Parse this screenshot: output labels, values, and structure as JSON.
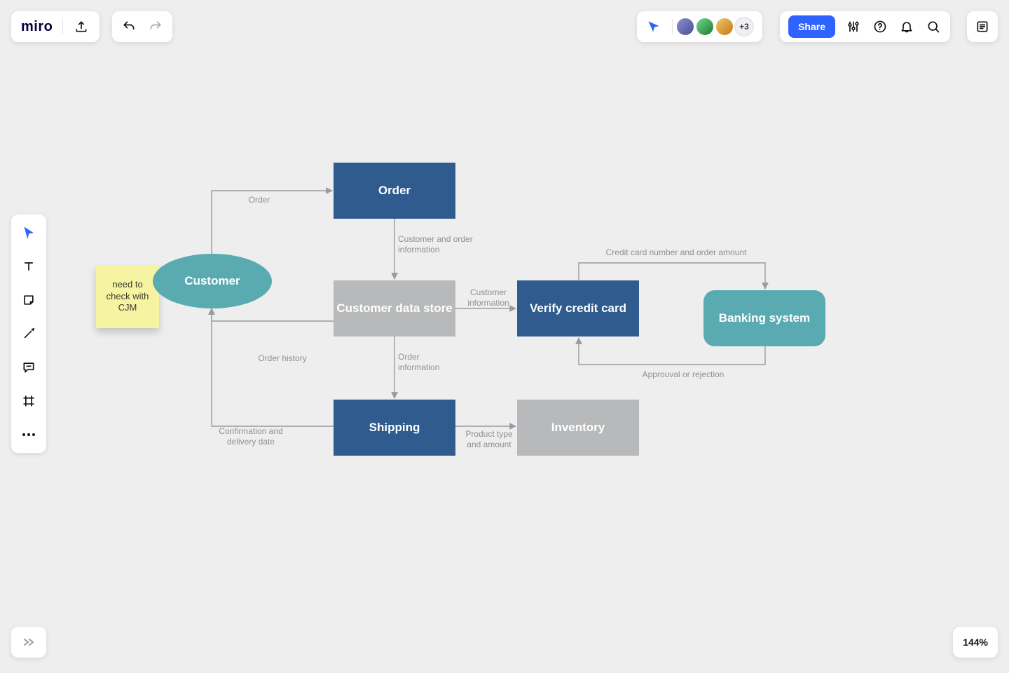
{
  "brand": {
    "name": "miro"
  },
  "presence": {
    "avatars_visible": 3,
    "overflow_label": "+3",
    "avatar_colors": [
      "#5b5f9e",
      "#2f9e44",
      "#e8a13a"
    ]
  },
  "actions": {
    "share_label": "Share"
  },
  "zoom": {
    "label": "144%"
  },
  "sticky": {
    "text": "need to check with CJM"
  },
  "nodes": {
    "customer": "Customer",
    "order": "Order",
    "cds": "Customer data store",
    "verify": "Verify credit card",
    "banking": "Banking system",
    "shipping": "Shipping",
    "inventory": "Inventory"
  },
  "labels": {
    "order_edge": "Order",
    "cust_order_info": "Customer and order\ninformation",
    "order_history": "Order history",
    "cust_info": "Customer\ninformation",
    "order_info": "Order\ninformation",
    "confirm": "Confirmation and\ndelivery date",
    "prod_amount": "Product type\nand amount",
    "cc_num": "Credit card number and order amount",
    "approval": "Approuval or rejection"
  },
  "chart_data": {
    "type": "flowchart",
    "title": "",
    "nodes": [
      {
        "id": "customer",
        "label": "Customer",
        "shape": "ellipse",
        "fill": "#5aaab2"
      },
      {
        "id": "order",
        "label": "Order",
        "shape": "rect",
        "fill": "#2f5b8e"
      },
      {
        "id": "cds",
        "label": "Customer data store",
        "shape": "rect",
        "fill": "#b8b9ba"
      },
      {
        "id": "verify",
        "label": "Verify credit card",
        "shape": "rect",
        "fill": "#2f5b8e"
      },
      {
        "id": "banking",
        "label": "Banking system",
        "shape": "rounded-rect",
        "fill": "#5aaab2"
      },
      {
        "id": "shipping",
        "label": "Shipping",
        "shape": "rect",
        "fill": "#2f5b8e"
      },
      {
        "id": "inventory",
        "label": "Inventory",
        "shape": "rect",
        "fill": "#b8b9ba"
      }
    ],
    "edges": [
      {
        "from": "customer",
        "to": "order",
        "label": "Order"
      },
      {
        "from": "order",
        "to": "cds",
        "label": "Customer and order information"
      },
      {
        "from": "cds",
        "to": "verify",
        "label": "Customer information"
      },
      {
        "from": "cds",
        "to": "shipping",
        "label": "Order information"
      },
      {
        "from": "verify",
        "to": "banking",
        "label": "Credit card number and order amount"
      },
      {
        "from": "banking",
        "to": "verify",
        "label": "Approuval or rejection"
      },
      {
        "from": "shipping",
        "to": "customer",
        "label": "Confirmation and delivery date"
      },
      {
        "from": "cds",
        "to": "customer",
        "label": "Order history"
      },
      {
        "from": "shipping",
        "to": "inventory",
        "label": "Product type and amount"
      }
    ],
    "annotations": [
      {
        "type": "sticky-note",
        "text": "need to check with CJM",
        "near": "customer"
      }
    ]
  }
}
